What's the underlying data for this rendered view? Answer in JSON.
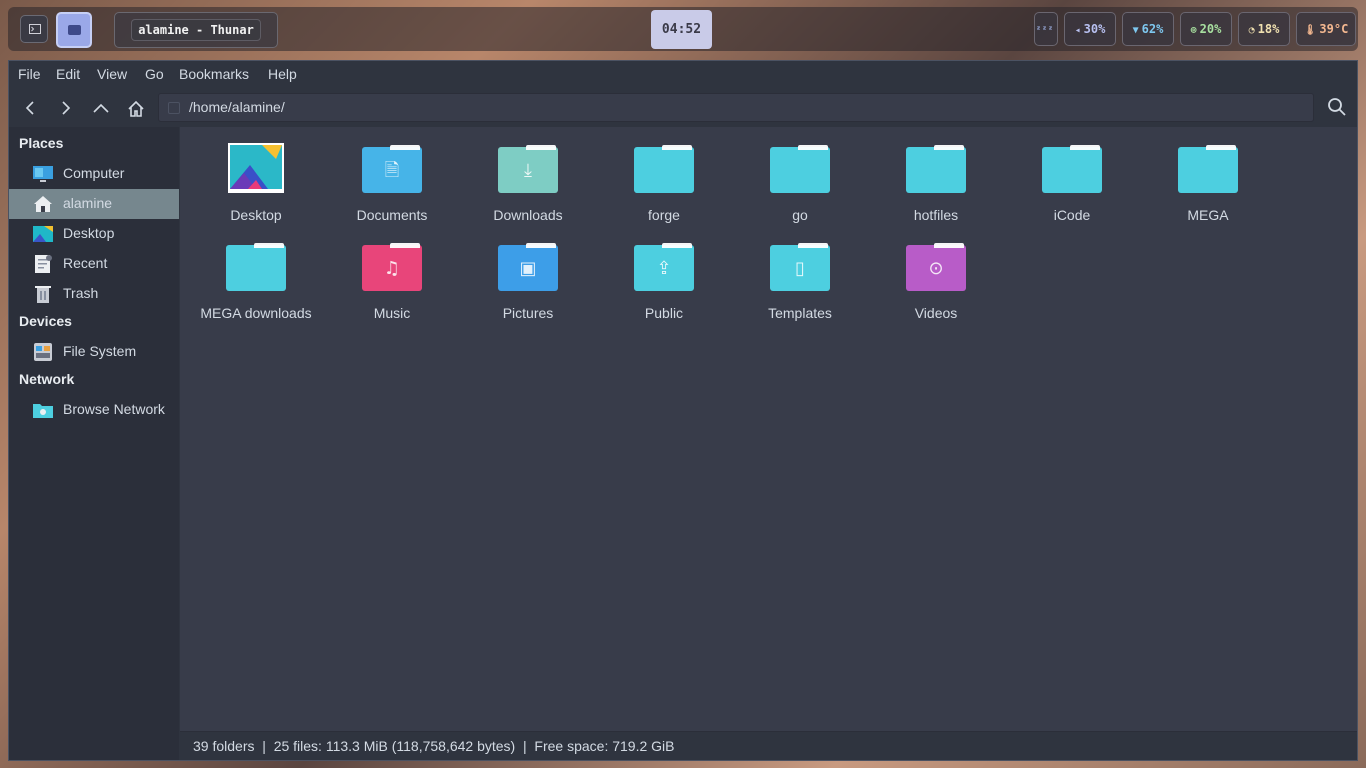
{
  "taskbar": {
    "window_title": "alamine - Thunar",
    "clock": "04:52",
    "stats": [
      {
        "icon": "sleep-icon",
        "glyph": "ᶻᶻᶻ",
        "value": "",
        "color": "#a0b4e8"
      },
      {
        "icon": "volume-icon",
        "glyph": "◂",
        "value": "30%",
        "color": "#b8c0f0"
      },
      {
        "icon": "wifi-icon",
        "glyph": "▼",
        "value": "62%",
        "color": "#7ec8f0"
      },
      {
        "icon": "cpu-icon",
        "glyph": "⊚",
        "value": "20%",
        "color": "#a8e0a0"
      },
      {
        "icon": "gauge-icon",
        "glyph": "◔",
        "value": "18%",
        "color": "#f0e0b0"
      },
      {
        "icon": "thermometer-icon",
        "glyph": "🌡",
        "value": "39°C",
        "color": "#f4b890"
      }
    ]
  },
  "menubar": [
    "File",
    "Edit",
    "View",
    "Go",
    "Bookmarks",
    "Help"
  ],
  "location": {
    "path": "/home/alamine/"
  },
  "sidebar": {
    "sections": [
      {
        "title": "Places",
        "items": [
          {
            "label": "Computer",
            "icon": "computer-icon"
          },
          {
            "label": "alamine",
            "icon": "home-icon",
            "active": true
          },
          {
            "label": "Desktop",
            "icon": "desktop-icon"
          },
          {
            "label": "Recent",
            "icon": "recent-icon"
          },
          {
            "label": "Trash",
            "icon": "trash-icon"
          }
        ]
      },
      {
        "title": "Devices",
        "items": [
          {
            "label": "File System",
            "icon": "filesystem-icon"
          }
        ]
      },
      {
        "title": "Network",
        "items": [
          {
            "label": "Browse Network",
            "icon": "network-icon"
          }
        ]
      }
    ]
  },
  "files": [
    {
      "label": "Desktop",
      "kind": "desktop",
      "color": "#2bb3c8"
    },
    {
      "label": "Documents",
      "kind": "documents",
      "color": "#46b4e8"
    },
    {
      "label": "Downloads",
      "kind": "downloads",
      "color": "#7ecdc4"
    },
    {
      "label": "forge",
      "kind": "folder",
      "color": "#4dcfe0"
    },
    {
      "label": "go",
      "kind": "folder",
      "color": "#4dcfe0"
    },
    {
      "label": "hotfiles",
      "kind": "folder",
      "color": "#4dcfe0"
    },
    {
      "label": "iCode",
      "kind": "folder",
      "color": "#4dcfe0"
    },
    {
      "label": "MEGA",
      "kind": "folder",
      "color": "#4dcfe0"
    },
    {
      "label": "MEGA downloads",
      "kind": "folder",
      "color": "#4dcfe0"
    },
    {
      "label": "Music",
      "kind": "music",
      "color": "#e8457a"
    },
    {
      "label": "Pictures",
      "kind": "pictures",
      "color": "#3d9ee8"
    },
    {
      "label": "Public",
      "kind": "public",
      "color": "#4dcfe0"
    },
    {
      "label": "Templates",
      "kind": "templates",
      "color": "#4dcfe0"
    },
    {
      "label": "Videos",
      "kind": "videos",
      "color": "#b85cc8"
    }
  ],
  "status": {
    "folders": "39 folders",
    "files": "25 files: 113.3 MiB (118,758,642 bytes)",
    "free": "Free space: 719.2 GiB"
  }
}
